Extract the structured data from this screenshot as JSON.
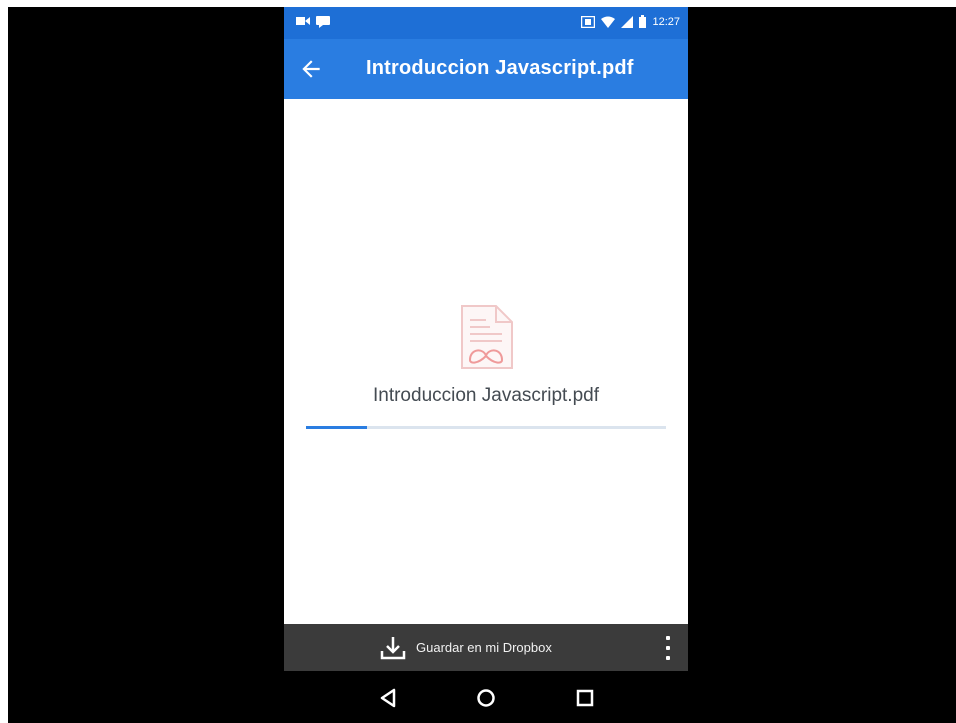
{
  "status_bar": {
    "time": "12:27",
    "icons": [
      "video-notification-icon",
      "chat-notification-icon",
      "nfc-icon",
      "wifi-icon",
      "cellular-signal-icon",
      "battery-icon"
    ]
  },
  "app_bar": {
    "back_icon": "arrow-back-icon",
    "title": "Introduccion Javascript.pdf",
    "color": "#2a7de1"
  },
  "document": {
    "icon": "pdf-file-icon",
    "file_name": "Introduccion Javascript.pdf",
    "download_progress": 0.17
  },
  "bottom_bar": {
    "save_icon": "download-icon",
    "save_label": "Guardar en mi Dropbox",
    "more_icon": "more-vert-icon"
  },
  "nav_bar": {
    "back": "nav-back-icon",
    "home": "nav-home-icon",
    "recents": "nav-recents-icon"
  }
}
